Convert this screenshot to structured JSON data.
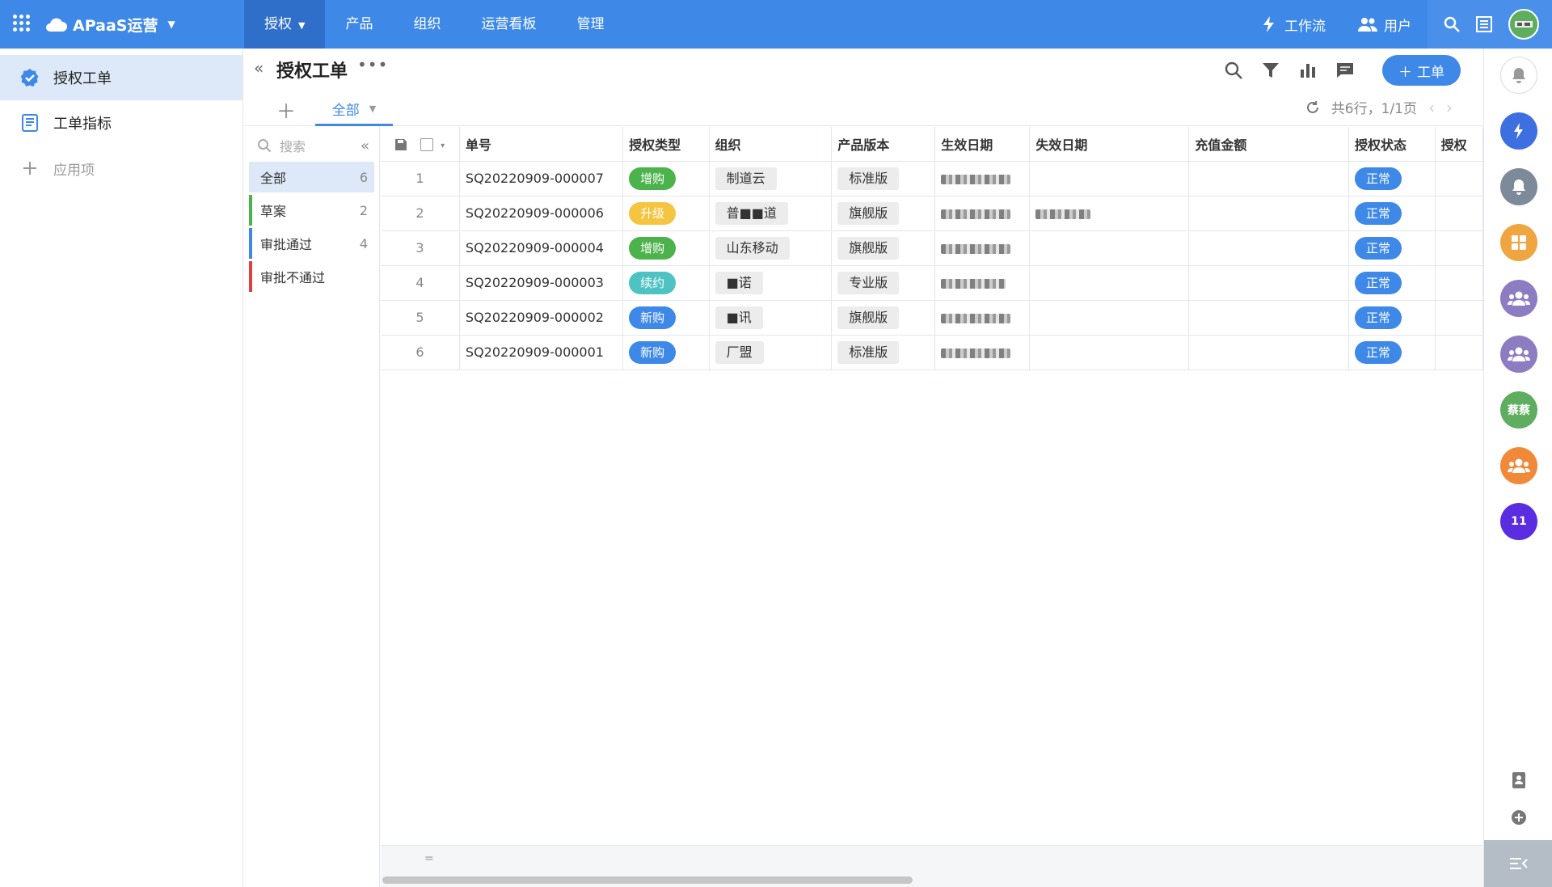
{
  "topbar": {
    "brand": "APaaS运营",
    "nav": [
      {
        "label": "授权",
        "active": true
      },
      {
        "label": "产品"
      },
      {
        "label": "组织"
      },
      {
        "label": "运营看板"
      },
      {
        "label": "管理"
      }
    ],
    "workflow": "工作流",
    "users": "用户",
    "accent": "#3e88e8"
  },
  "sidebar": {
    "items": [
      {
        "label": "授权工单",
        "icon": "badge-check-icon",
        "active": true
      },
      {
        "label": "工单指标",
        "icon": "report-icon"
      },
      {
        "label": "应用项",
        "icon": "plus-icon"
      }
    ]
  },
  "header": {
    "title": "授权工单",
    "tab_all": "全部",
    "pager": "共6行，1/1页",
    "new_button": "工单"
  },
  "filter": {
    "search_placeholder": "搜索",
    "items": [
      {
        "label": "全部",
        "count": "6",
        "color": ""
      },
      {
        "label": "草案",
        "count": "2",
        "color": "#4cb34c"
      },
      {
        "label": "审批通过",
        "count": "4",
        "color": "#3e88e8"
      },
      {
        "label": "审批不通过",
        "count": "",
        "color": "#e04040"
      }
    ]
  },
  "table": {
    "columns": [
      "单号",
      "授权类型",
      "组织",
      "产品版本",
      "生效日期",
      "失效日期",
      "充值金额",
      "授权状态",
      "授权"
    ],
    "rows": [
      {
        "idx": "1",
        "id": "SQ20220909-000007",
        "type": "增购",
        "type_color": "#4cb34c",
        "org": "制道云",
        "version": "标准版",
        "status": "正常"
      },
      {
        "idx": "2",
        "id": "SQ20220909-000006",
        "type": "升级",
        "type_color": "#f5c542",
        "org": "普■■道",
        "version": "旗舰版",
        "status": "正常"
      },
      {
        "idx": "3",
        "id": "SQ20220909-000004",
        "type": "增购",
        "type_color": "#4cb34c",
        "org": "山东移动",
        "version": "旗舰版",
        "status": "正常"
      },
      {
        "idx": "4",
        "id": "SQ20220909-000003",
        "type": "续约",
        "type_color": "#4fc3c3",
        "org": "■诺",
        "version": "专业版",
        "status": "正常"
      },
      {
        "idx": "5",
        "id": "SQ20220909-000002",
        "type": "新购",
        "type_color": "#3e88e8",
        "org": "■讯",
        "version": "旗舰版",
        "status": "正常"
      },
      {
        "idx": "6",
        "id": "SQ20220909-000001",
        "type": "新购",
        "type_color": "#3e88e8",
        "org": "厂盟",
        "version": "标准版",
        "status": "正常"
      }
    ]
  },
  "bottom": {
    "symbol": "="
  },
  "rail": {
    "buttons": [
      {
        "label": "",
        "color": "#ffffff",
        "icon": "bell-icon"
      },
      {
        "label": "",
        "color": "#3e6fe0",
        "icon": "sparkle-icon"
      },
      {
        "label": "",
        "color": "#7d8a99",
        "icon": "bell-icon"
      },
      {
        "label": "",
        "color": "#f0a640",
        "icon": "grid-icon"
      },
      {
        "label": "",
        "color": "#8e7cc3",
        "icon": "group-icon"
      },
      {
        "label": "",
        "color": "#8e7cc3",
        "icon": "group-icon"
      },
      {
        "label": "蔡蔡",
        "color": "#5fae5f",
        "icon": ""
      },
      {
        "label": "",
        "color": "#f08a3a",
        "icon": "group-icon"
      },
      {
        "label": "11",
        "color": "#5b2de0",
        "icon": ""
      }
    ]
  }
}
